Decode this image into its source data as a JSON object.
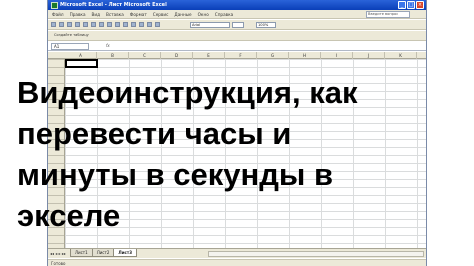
{
  "window": {
    "title": "Microsoft Excel - Лист Microsoft Excel"
  },
  "menu": {
    "items": [
      "Файл",
      "Правка",
      "Вид",
      "Вставка",
      "Формат",
      "Сервис",
      "Данные",
      "Окно",
      "Справка"
    ],
    "help_placeholder": "Введите вопрос"
  },
  "toolbar": {
    "font_name": "Arial",
    "zoom": "100%",
    "second_row_label": "Создайте таблицу"
  },
  "formula_bar": {
    "name_box": "A1",
    "fx": "fx"
  },
  "grid": {
    "columns": [
      "A",
      "B",
      "C",
      "D",
      "E",
      "F",
      "G",
      "H",
      "I",
      "J",
      "K"
    ]
  },
  "overlay_text": {
    "line1": "Видеоинструкция, как",
    "line2": "перевести часы и",
    "line3": "минуты в секунды в",
    "line4": "экселе"
  },
  "sheets": {
    "nav": "◂◂ ◂ ▸ ▸▸",
    "tabs": [
      "Лист1",
      "Лист2",
      "Лист3"
    ],
    "active_index": 2
  },
  "status": {
    "text": "Готово"
  }
}
